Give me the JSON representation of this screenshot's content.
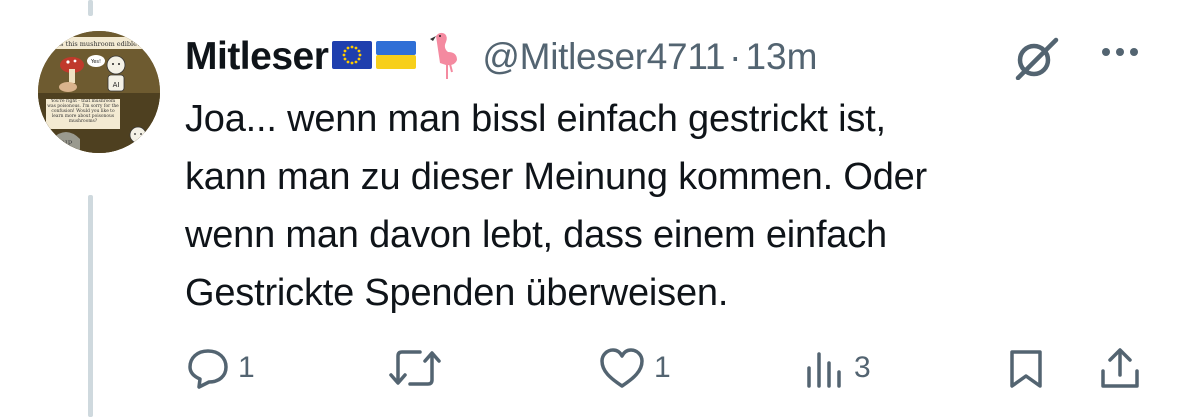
{
  "tweet": {
    "author_name": "Mitleser",
    "handle": "@Mitleser4711",
    "separator": "·",
    "time": "13m",
    "text_lines": [
      "Joa... wenn man bissl einfach gestrickt ist,",
      "kann man zu dieser Meinung kommen. Oder",
      "wenn man davon lebt, dass einem einfach",
      "Gestrickte Spenden überweisen."
    ]
  },
  "avatar": {
    "caption_top": "Is this mushroom edible?",
    "bubble_yes": "Yes!",
    "robot_label": "AI",
    "caption_bottom": "You're right - that mushroom was poisonous. I'm sorry for the confusion! Would you like to learn more about poisonous mushrooms?",
    "grave_label": "RIP"
  },
  "actions": {
    "reply_count": "1",
    "like_count": "1",
    "views_count": "3"
  },
  "icons": {
    "reply": "reply-icon",
    "retweet": "retweet-icon",
    "like": "heart-icon",
    "views": "views-icon",
    "bookmark": "bookmark-icon",
    "share": "share-icon",
    "grok": "grok-icon",
    "more": "more-icon",
    "eu_flag": "eu-flag-icon",
    "ua_flag": "ukraine-flag-icon",
    "flamingo": "flamingo-icon"
  },
  "colors": {
    "text": "#0f1419",
    "secondary": "#536471",
    "thread": "#cfd9de"
  }
}
